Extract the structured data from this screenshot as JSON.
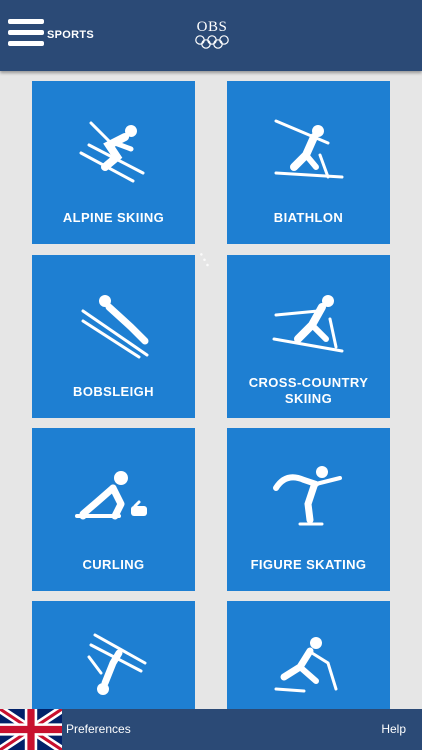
{
  "header": {
    "menu_label": "SPORTS",
    "logo_text": "OBS"
  },
  "tiles": [
    {
      "label": "ALPINE SKIING",
      "icon": "alpine-skiing-icon"
    },
    {
      "label": "BIATHLON",
      "icon": "biathlon-icon"
    },
    {
      "label": "BOBSLEIGH",
      "icon": "ski-jumping-icon"
    },
    {
      "label": "CROSS-COUNTRY SKIING",
      "icon": "cross-country-skiing-icon"
    },
    {
      "label": "CURLING",
      "icon": "curling-icon"
    },
    {
      "label": "FIGURE SKATING",
      "icon": "figure-skating-icon"
    },
    {
      "label": "",
      "icon": "freestyle-skiing-icon"
    },
    {
      "label": "",
      "icon": "ice-hockey-icon"
    }
  ],
  "footer": {
    "preferences_label": "Preferences",
    "help_label": "Help"
  },
  "colors": {
    "header_bg": "#2b4a76",
    "tile_bg": "#1e7fd2",
    "page_bg": "#e6e6e6"
  }
}
